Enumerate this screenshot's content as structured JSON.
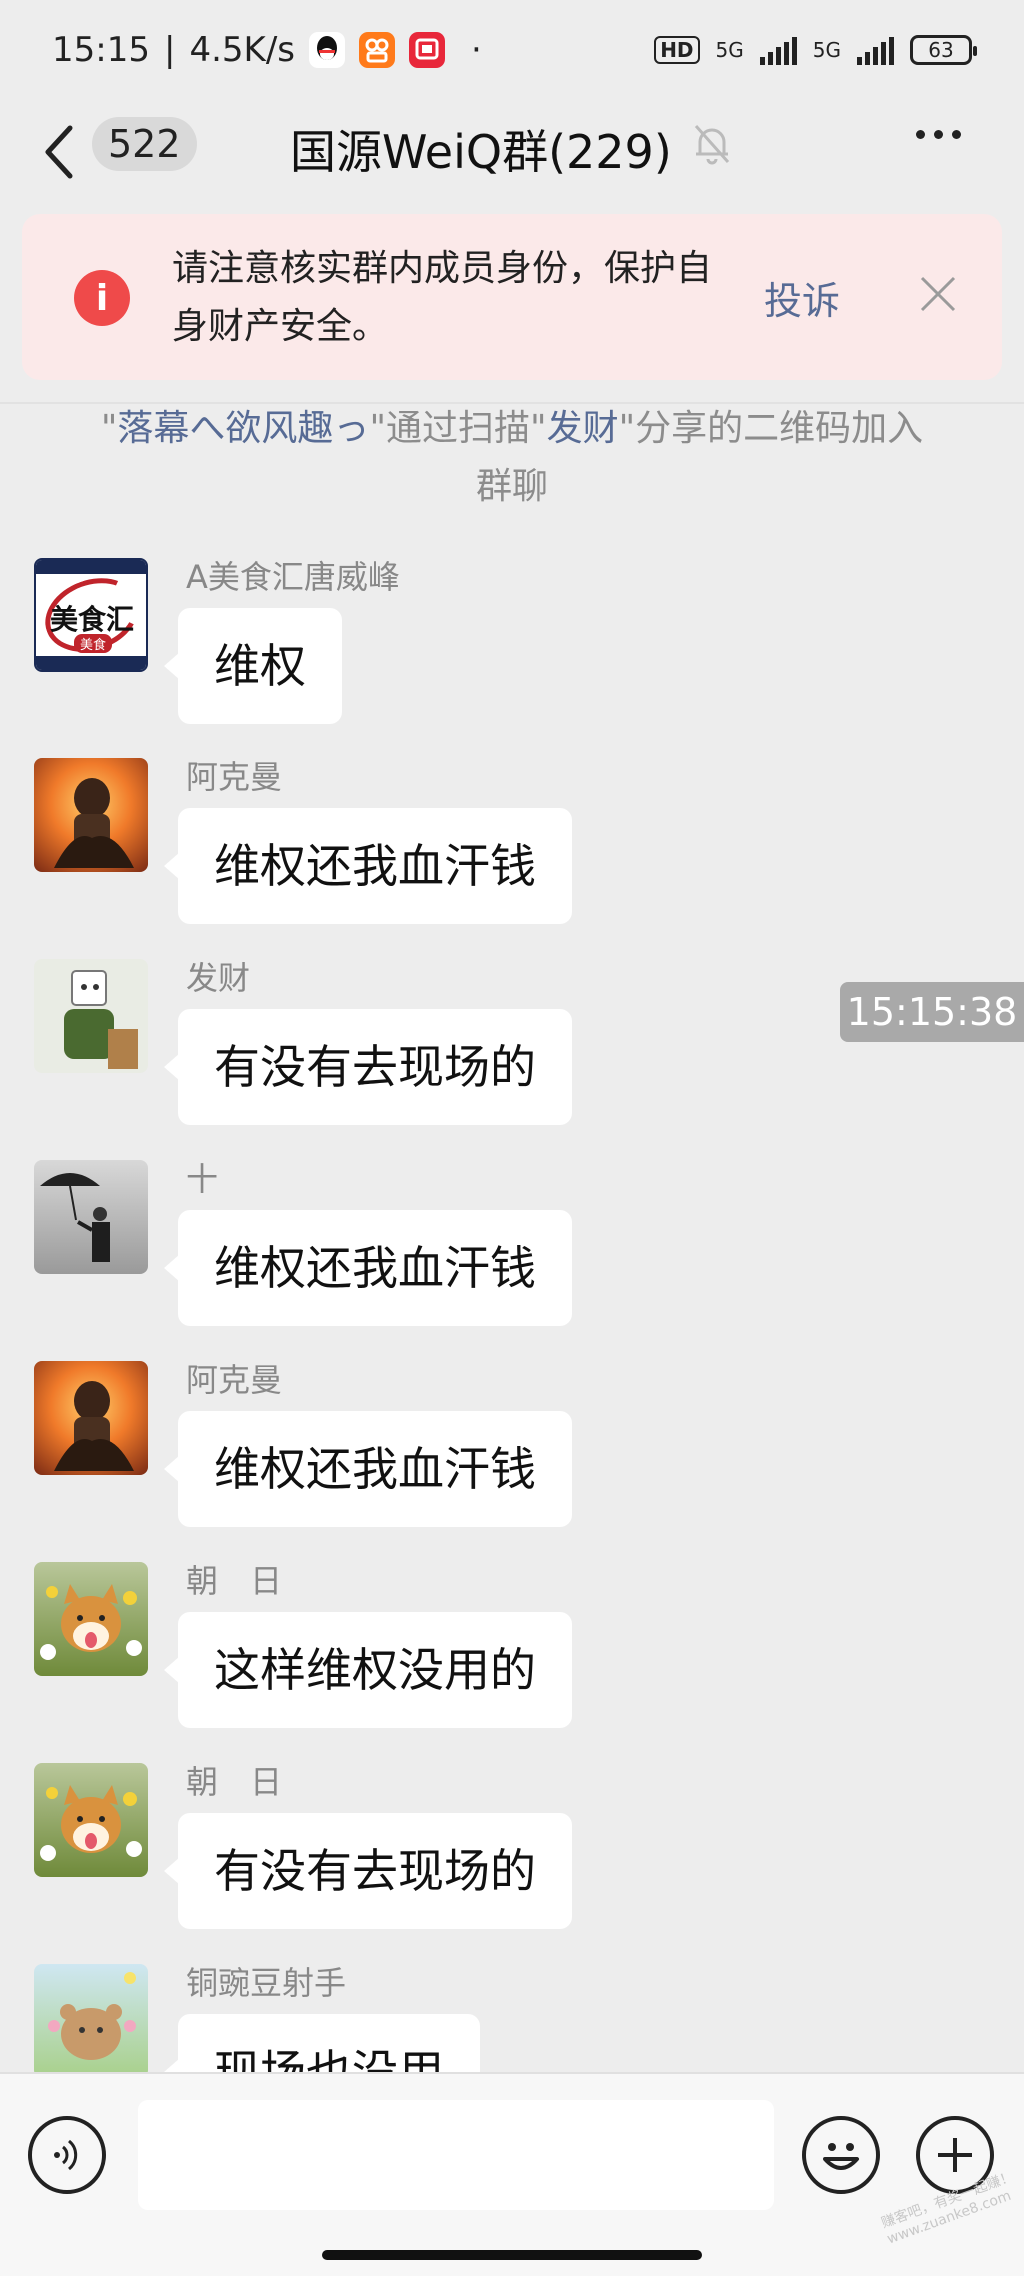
{
  "status_bar": {
    "time": "15:15",
    "speed": "4.5K/s",
    "dot": "·",
    "hd": "HD",
    "net1": "5G",
    "net2": "5G",
    "battery": "63"
  },
  "header": {
    "unread_count": "522",
    "title": "国源WeiQ群(229)"
  },
  "banner": {
    "message": "请注意核实群内成员身份，保护自身财产安全。",
    "complain": "投诉"
  },
  "system_message": {
    "q1": "\"",
    "inviter": "落幕へ欲风趣っ",
    "mid": "\"通过扫描\"",
    "sharer": "发财",
    "tail": "\"分享的二维码加入群聊"
  },
  "timestamp": "15:15:38",
  "messages": [
    {
      "sender": "A美食汇唐威峰",
      "text": "维权",
      "avatar": "food-logo-avatar"
    },
    {
      "sender": "阿克曼",
      "text": "维权还我血汗钱",
      "avatar": "anime-fire-avatar"
    },
    {
      "sender": "发财",
      "text": "有没有去现场的",
      "avatar": "cartoon-man-avatar"
    },
    {
      "sender": "十",
      "text": "维权还我血汗钱",
      "avatar": "umbrella-man-avatar"
    },
    {
      "sender": "阿克曼",
      "text": "维权还我血汗钱",
      "avatar": "anime-fire-avatar"
    },
    {
      "sender": "朝　日",
      "text": "这样维权没用的",
      "avatar": "shiba-dog-avatar"
    },
    {
      "sender": "朝　日",
      "text": "有没有去现场的",
      "avatar": "shiba-dog-avatar"
    },
    {
      "sender": "铜豌豆射手",
      "text": "现场也没用",
      "avatar": "bear-cartoon-avatar"
    }
  ],
  "avatar_logo_text": {
    "main": "美食汇",
    "badge": "美食"
  },
  "input_bar": {
    "placeholder": ""
  },
  "watermark": "赚客吧，有奖一起赚！ www.zuanke8.com",
  "colors": {
    "link": "#576b95",
    "warning": "#ef4a4a",
    "banner_bg": "#fbe9e9",
    "page_bg": "#ededed"
  }
}
